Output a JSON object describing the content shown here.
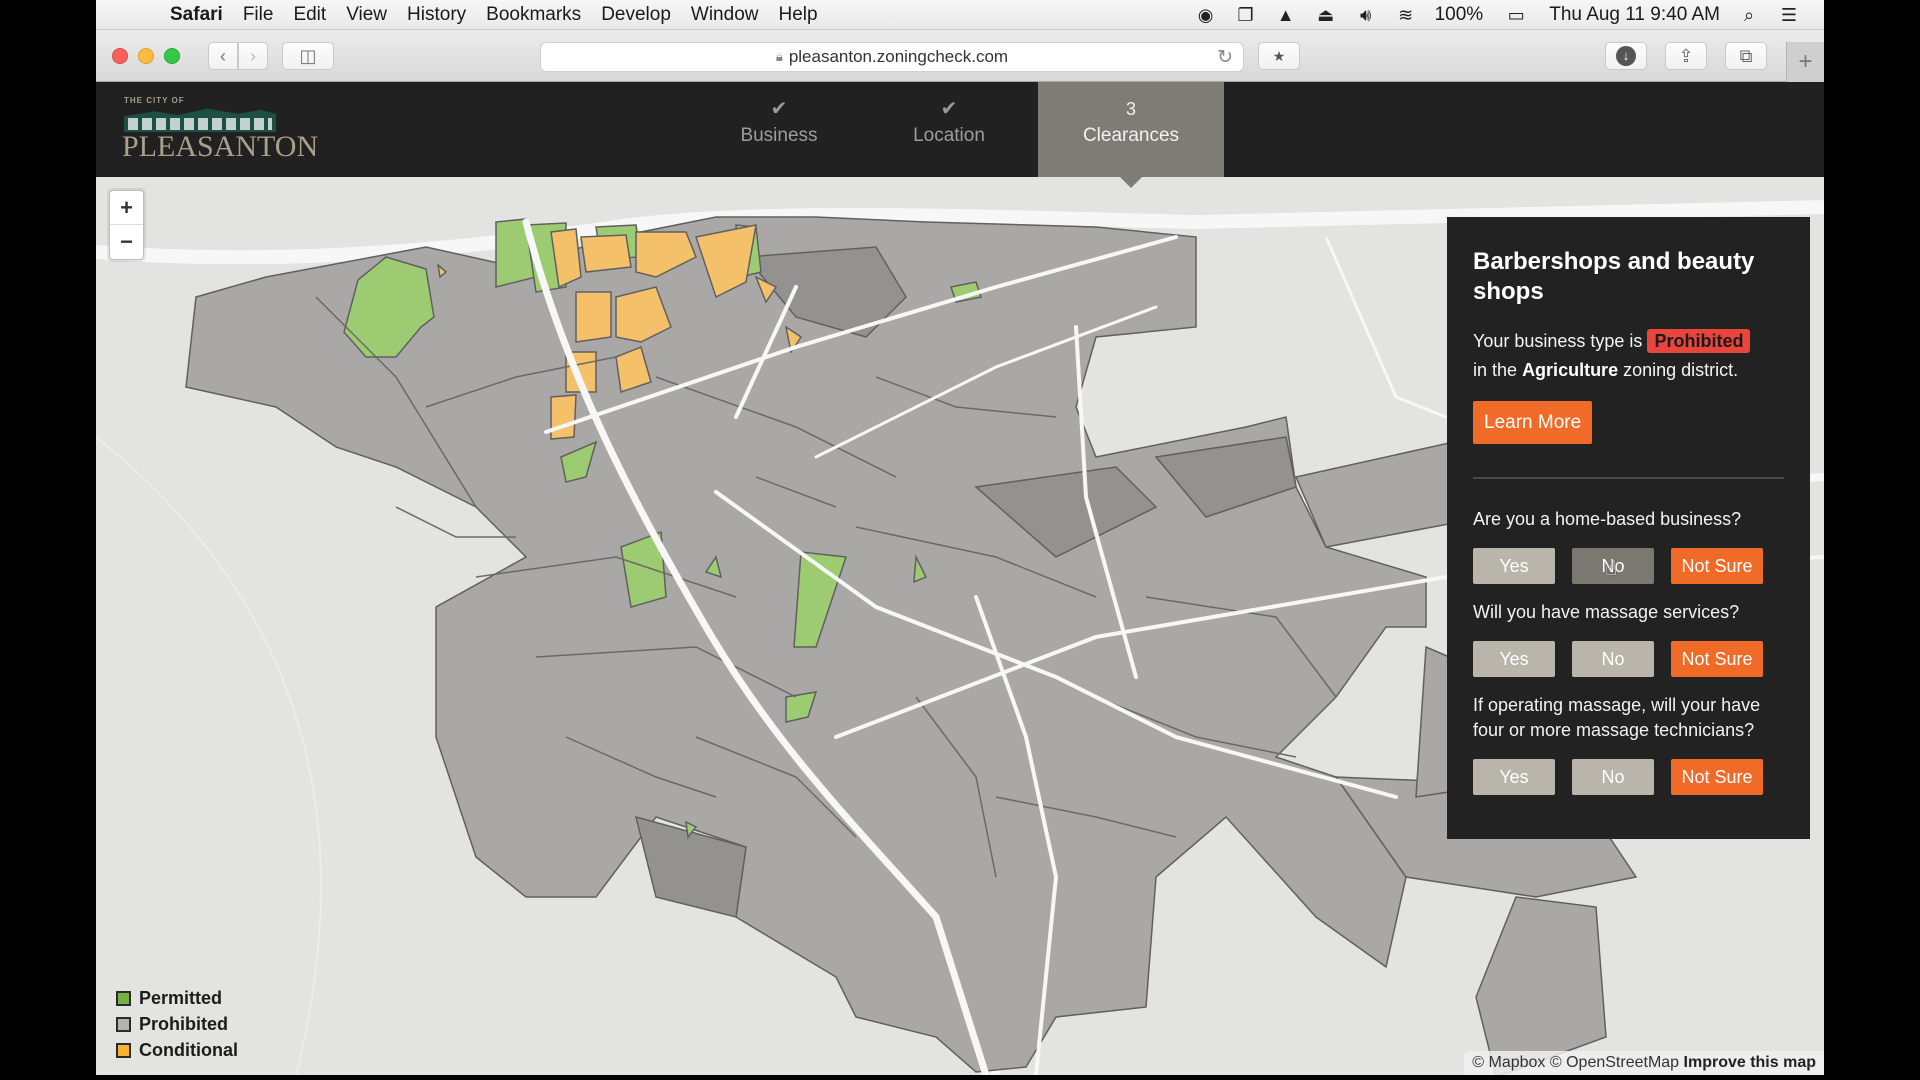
{
  "menubar": {
    "apple": "",
    "app_name": "Safari",
    "menus": [
      "File",
      "Edit",
      "View",
      "History",
      "Bookmarks",
      "Develop",
      "Window",
      "Help"
    ],
    "tray_icons": [
      "screen-record-icon",
      "chat-icon",
      "drive-icon",
      "airplay-icon",
      "volume-icon",
      "wifi-icon"
    ],
    "battery": "100%",
    "datetime": "Thu Aug 11  9:40 AM"
  },
  "browser": {
    "url": "pleasanton.zoningcheck.com"
  },
  "site": {
    "logo_small": "THE CITY OF",
    "logo_name": "PLEASANTON",
    "steps": [
      {
        "mark": "✔",
        "label": "Business",
        "state": "complete"
      },
      {
        "mark": "✔",
        "label": "Location",
        "state": "complete"
      },
      {
        "mark": "3",
        "label": "Clearances",
        "state": "active"
      }
    ]
  },
  "map": {
    "zoom_in": "+",
    "zoom_out": "−",
    "legend": [
      {
        "label": "Permitted",
        "color": "#74b043"
      },
      {
        "label": "Prohibited",
        "color": "#b3b3b1"
      },
      {
        "label": "Conditional",
        "color": "#f5b233"
      }
    ],
    "attribution": {
      "mapbox": "© Mapbox",
      "osm": "© OpenStreetMap",
      "improve": "Improve this map"
    },
    "colors": {
      "permitted": "#9ccb72",
      "prohibited": "#a9a8a6",
      "conditional": "#f4c06a",
      "background": "#e3e3e1"
    }
  },
  "panel": {
    "title": "Barbershops and beauty shops",
    "status_prefix": "Your business type is",
    "status_badge": "Prohibited",
    "status_mid": "in the",
    "district": "Agriculture",
    "status_suffix": "zoning district.",
    "learn_more": "Learn More",
    "questions": [
      {
        "text": "Are you a home-based business?",
        "answers": [
          "Yes",
          "No",
          "Not Sure"
        ],
        "selected": "Not Sure"
      },
      {
        "text": "Will you have massage services?",
        "answers": [
          "Yes",
          "No",
          "Not Sure"
        ],
        "selected": "Not Sure"
      },
      {
        "text": "If operating massage, will your have four or more massage technicians?",
        "answers": [
          "Yes",
          "No",
          "Not Sure"
        ],
        "selected": "Not Sure"
      }
    ],
    "accent": "#f06a28",
    "badge_color": "#e8453c"
  }
}
